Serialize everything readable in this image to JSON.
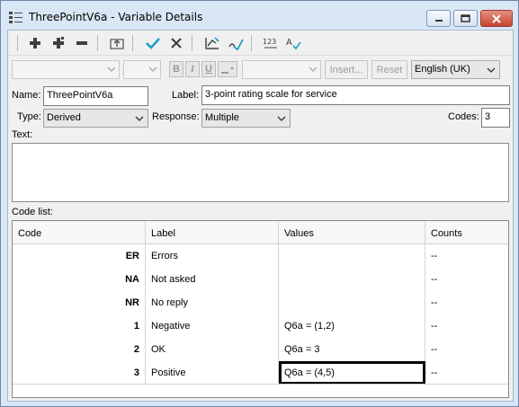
{
  "window": {
    "title": "ThreePointV6a - Variable Details",
    "icons": {
      "app": "variable-list-icon",
      "minimize": "minimize-icon",
      "maximize": "maximize-icon",
      "close": "close-icon"
    },
    "close_color": "#c44631"
  },
  "toolbar": {
    "icons": [
      "add-icon",
      "add-multiple-icon",
      "remove-icon",
      "move-up-icon",
      "apply-check-icon",
      "cancel-x-icon",
      "chart-edit-icon",
      "validate-icon",
      "numbering-icon",
      "spell-check-icon"
    ],
    "accent": "#1fa0c8"
  },
  "formatbar": {
    "bold": "B",
    "italic": "I",
    "underline": "U",
    "insert_label": "Insert...",
    "reset_label": "Reset",
    "language_value": "English (UK)"
  },
  "form": {
    "name_label": "Name:",
    "name_value": "ThreePointV6a",
    "label_label": "Label:",
    "label_value": "3-point rating scale for service",
    "type_label": "Type:",
    "type_value": "Derived",
    "response_label": "Response:",
    "response_value": "Multiple",
    "codes_label": "Codes:",
    "codes_value": "3",
    "text_label": "Text:",
    "codelist_label": "Code list:"
  },
  "grid": {
    "headers": [
      "Code",
      "Label",
      "Values",
      "Counts"
    ],
    "rows": [
      {
        "code": "ER",
        "label": "Errors",
        "values": "",
        "counts": "--"
      },
      {
        "code": "NA",
        "label": "Not asked",
        "values": "",
        "counts": "--"
      },
      {
        "code": "NR",
        "label": "No reply",
        "values": "",
        "counts": "--"
      },
      {
        "code": "1",
        "label": "Negative",
        "values": "Q6a = (1,2)",
        "counts": "--"
      },
      {
        "code": "2",
        "label": "OK",
        "values": "Q6a = 3",
        "counts": "--"
      },
      {
        "code": "3",
        "label": "Positive",
        "values": "Q6a = (4,5)",
        "counts": "--"
      }
    ]
  }
}
